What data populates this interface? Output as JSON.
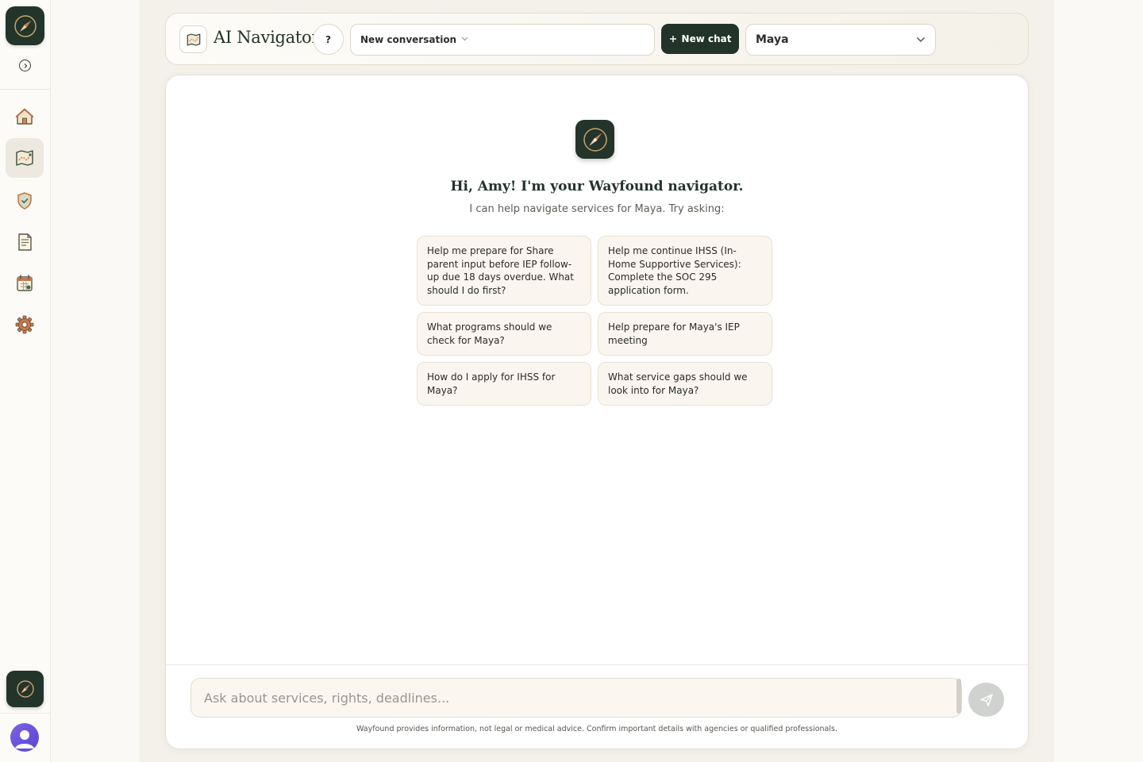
{
  "app": {
    "title": "AI Navigator",
    "help_label": "?",
    "accent": "#23342b"
  },
  "rail": {
    "logo_icon": "compass-icon",
    "items": [
      {
        "name": "home",
        "icon": "home-icon",
        "active": false
      },
      {
        "name": "navigator",
        "icon": "map-icon",
        "active": true
      },
      {
        "name": "rights",
        "icon": "shield-icon",
        "active": false
      },
      {
        "name": "documents",
        "icon": "document-icon",
        "active": false
      },
      {
        "name": "calendar",
        "icon": "calendar-icon",
        "active": false
      },
      {
        "name": "settings",
        "icon": "gear-icon",
        "active": false
      }
    ]
  },
  "header": {
    "conversation_select": "New conversation",
    "new_chat_label": "New chat",
    "child_select": "Maya"
  },
  "chat": {
    "greeting": "Hi, Amy! I'm your Wayfound navigator.",
    "subtitle": "I can help navigate services for Maya. Try asking:",
    "prompts": [
      "Help me prepare for Share parent input before IEP follow-up due 18 days overdue. What should I do first?",
      "Help me continue IHSS (In-Home Supportive Services): Complete the SOC 295 application form.",
      "What programs should we check for Maya?",
      "Help prepare for Maya's IEP meeting",
      "How do I apply for IHSS for Maya?",
      "What service gaps should we look into for Maya?"
    ],
    "input_placeholder": "Ask about services, rights, deadlines...",
    "disclaimer": "Wayfound provides information, not legal or medical advice. Confirm important details with agencies or qualified professionals."
  }
}
